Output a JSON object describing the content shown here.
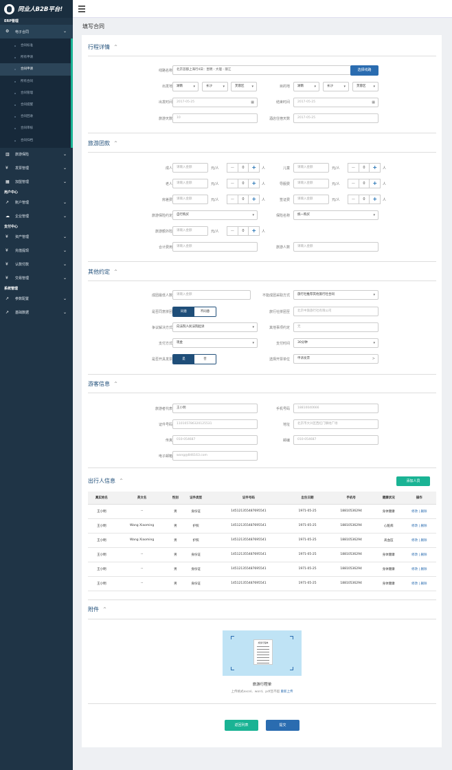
{
  "brand": {
    "name": "同业人B2B平台!"
  },
  "sidebar": {
    "sections": [
      {
        "title": "ERP管理",
        "items": [
          {
            "label": "电子合同",
            "icon": "gear-icon",
            "open": true,
            "children": [
              "合同标准",
              "所有申请",
              "合同申请",
              "所有合同",
              "合同管理",
              "合同提醒",
              "合同回收",
              "合同审核",
              "合同归档"
            ]
          },
          {
            "label": "旅游保险",
            "icon": "bank-icon"
          },
          {
            "label": "发票管理",
            "icon": "yen-icon"
          },
          {
            "label": "加盟管理",
            "icon": "table-icon"
          }
        ]
      },
      {
        "title": "用户中心",
        "items": [
          {
            "label": "账户管理",
            "icon": "chart-icon"
          },
          {
            "label": "企业管理",
            "icon": "cloud-icon"
          }
        ]
      },
      {
        "title": "支付中心",
        "items": [
          {
            "label": "资产管理",
            "icon": "yen-icon"
          },
          {
            "label": "充值提现",
            "icon": "yen-icon"
          },
          {
            "label": "认款付款",
            "icon": "yen-icon"
          },
          {
            "label": "交易管理",
            "icon": "yen-icon"
          }
        ]
      },
      {
        "title": "系统管理",
        "items": [
          {
            "label": "参数配置",
            "icon": "chart-icon"
          },
          {
            "label": "基础数据",
            "icon": "chart-icon"
          }
        ]
      }
    ]
  },
  "page": {
    "title": "填写合同"
  },
  "trip": {
    "title": "行程详情",
    "route_label": "线路名称",
    "route_value": "北京首都上海行4日：昆明 - 大理 - 丽江",
    "route_button": "选择线路",
    "origin_label": "出发地",
    "origin": [
      "湖南",
      "长沙",
      "芙蓉区"
    ],
    "dest_label": "目的地",
    "dest": [
      "湖南",
      "长沙",
      "芙蓉区"
    ],
    "depart_label": "出发时间",
    "depart_value": "2017-05-25",
    "end_label": "结束时间",
    "end_value": "2017-05-25",
    "days_label": "旅游天数",
    "days_value": "10",
    "hotel_label": "酒店住宿天数",
    "hotel_value": "2017-05-25"
  },
  "group": {
    "title": "旅游团款",
    "fees": [
      {
        "label": "成人",
        "placeholder": "请输入金额",
        "unit": "元/人",
        "count": "0",
        "count_unit": "人"
      },
      {
        "label": "儿童",
        "placeholder": "请输入金额",
        "unit": "元/人",
        "count": "0",
        "count_unit": "人"
      },
      {
        "label": "老人",
        "placeholder": "请输入金额",
        "unit": "元/人",
        "count": "0",
        "count_unit": "人"
      },
      {
        "label": "导服费",
        "placeholder": "请输入金额",
        "unit": "元/人",
        "count": "0",
        "count_unit": "人"
      },
      {
        "label": "房差费",
        "placeholder": "请输入金额",
        "unit": "元/人",
        "count": "0",
        "count_unit": "人"
      },
      {
        "label": "签证费",
        "placeholder": "请输入金额",
        "unit": "元/人",
        "count": "0",
        "count_unit": "人"
      }
    ],
    "insurance_label": "旅游保险约定",
    "insurance_value": "自行购买",
    "ins_name_label": "保险名称",
    "ins_name_value": "统一购买",
    "extra_label": "旅游额外险",
    "extra_placeholder": "请输入金额",
    "extra_unit": "元/人",
    "extra_count": "0",
    "extra_count_unit": "人",
    "total_label": "合计费用",
    "total_placeholder": "请输入金额",
    "people_label": "旅游人数",
    "people_placeholder": "请输入金额"
  },
  "other": {
    "title": "其他约定",
    "min_label": "成团最低人数",
    "min_placeholder": "请输入金额",
    "fail_label": "不能成团采取方式",
    "fail_value": "旅行社推荐其他旅行社合同",
    "merge_label": "是否同意拼团",
    "merge_opts": [
      "同意",
      "不同意"
    ],
    "agency_label": "旅行社拼团至",
    "agency_value": "北京中旅旅行社有限公司",
    "dispute_label": "争议解决方式",
    "dispute_value": "向法院人民法院起诉",
    "note_label": "其他事项约定",
    "note_value": "无",
    "pay_label": "支付方式",
    "pay_value": "现金",
    "paytime_label": "支付时间",
    "paytime_value": "30分钟",
    "invoice_label": "是否开具发票",
    "invoice_opts": [
      "是",
      "否"
    ],
    "unit_label": "选择开票单位",
    "unit_value": "申请发票"
  },
  "guest": {
    "title": "游客信息",
    "rep_label": "旅游者代表",
    "rep_value": "王小明",
    "phone_label": "手机号码",
    "phone_value": "18810040666",
    "id_label": "证件号码",
    "id_value": "110105786320125531",
    "addr_label": "地址",
    "addr_value": "北京市大兴区西红门镇地广场",
    "fax_label": "传真",
    "fax_value": "010-054687",
    "zip_label": "邮编",
    "zip_value": "010-054687",
    "email_label": "电子邮箱",
    "email_value": "wang@846163.com"
  },
  "travelers": {
    "title": "出行人信息",
    "add_button": "添加人员",
    "headers": [
      "真实姓名",
      "英文名",
      "性别",
      "证件类型",
      "证件号码",
      "出生日期",
      "手机号",
      "健康状况",
      "操作"
    ],
    "rows": [
      [
        "王小明",
        "--",
        "男",
        "身份证",
        "145121355487695541",
        "1971-05-25",
        "18810536294",
        "身体健康",
        "修改 | 删除"
      ],
      [
        "王小明",
        "Wang Xiaoming",
        "男",
        "护照",
        "145121355487695541",
        "1971-05-25",
        "18810536294",
        "心脏病",
        "修改 | 删除"
      ],
      [
        "王小明",
        "Wang Xiaoming",
        "男",
        "护照",
        "145121355487695541",
        "1971-05-25",
        "18810536294",
        "高血压",
        "修改 | 删除"
      ],
      [
        "王小明",
        "--",
        "男",
        "身份证",
        "145121355487695541",
        "1971-05-25",
        "18810536294",
        "身体健康",
        "修改 | 删除"
      ],
      [
        "王小明",
        "--",
        "男",
        "身份证",
        "145121355487695541",
        "1971-05-25",
        "18810536294",
        "身体健康",
        "修改 | 删除"
      ],
      [
        "王小明",
        "--",
        "男",
        "身份证",
        "145121355487695541",
        "1971-05-25",
        "18810536294",
        "身体健康",
        "修改 | 删除"
      ]
    ]
  },
  "attach": {
    "title": "附件",
    "file_name": "旅游行程单",
    "hint": "上传格式excel、word、pdf且不超",
    "reupload": "重新上传",
    "doc_title": "旅游行程单"
  },
  "actions": {
    "back": "返回列表",
    "submit": "提交"
  }
}
